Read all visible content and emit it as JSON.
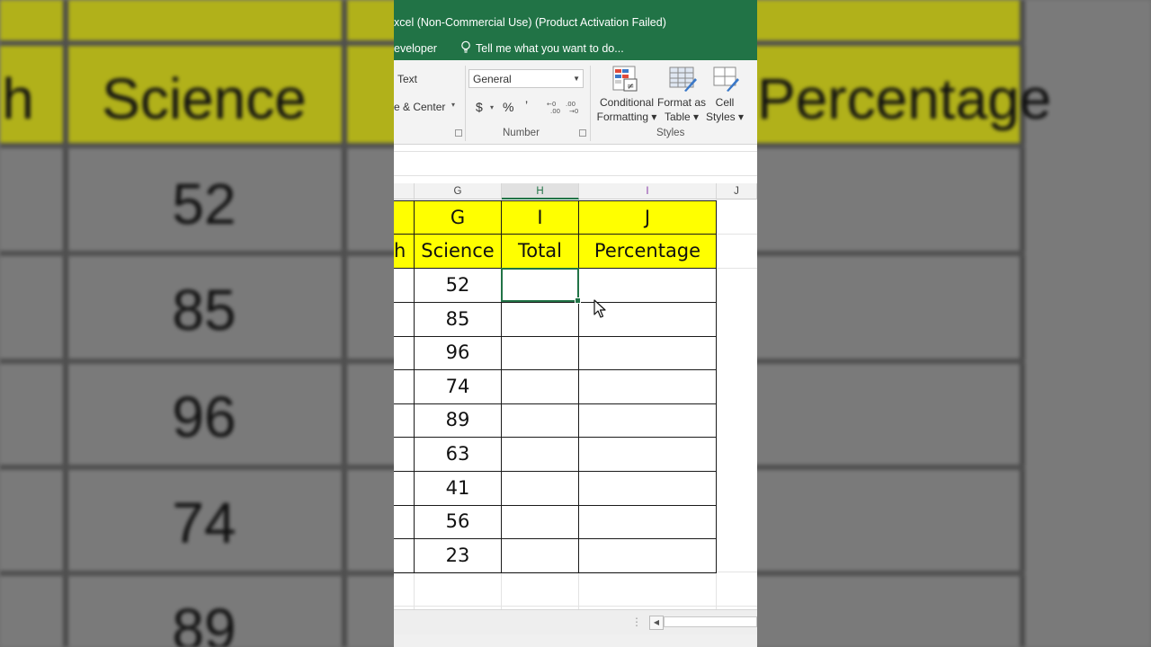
{
  "window": {
    "title": "xcel (Non-Commercial Use) (Product Activation Failed)"
  },
  "menu": {
    "tab_partial": "eveloper",
    "tell_me": "Tell me what you want to do..."
  },
  "ribbon": {
    "wrap_text_partial": "Text",
    "merge_center_partial": "e & Center",
    "number_format": "General",
    "currency_symbol": "$",
    "percent_symbol": "%",
    "comma_symbol": "’",
    "decimal_increase": "←.0 .00",
    "number_group_label": "Number",
    "conditional_formatting_line1": "Conditional",
    "conditional_formatting_line2": "Formatting ▾",
    "format_as_table_line1": "Format as",
    "format_as_table_line2": "Table ▾",
    "cell_styles_line1": "Cell",
    "cell_styles_line2": "Styles ▾",
    "styles_group_label": "Styles"
  },
  "sheet": {
    "column_headers": [
      "G",
      "H",
      "I",
      "J"
    ],
    "header_row_letters": [
      "G",
      "I",
      "J"
    ],
    "header_row_labels": [
      "h",
      "Science",
      "Total",
      "Percentage"
    ],
    "science_scores": [
      "52",
      "85",
      "96",
      "74",
      "89",
      "63",
      "41",
      "56",
      "23"
    ],
    "selected_column": "H"
  },
  "background": {
    "labels": [
      "h",
      "Science",
      "Percentage"
    ],
    "values": [
      "52",
      "85",
      "96",
      "74",
      "89"
    ]
  },
  "colors": {
    "excel_green": "#217346",
    "header_yellow": "#ffff00"
  }
}
